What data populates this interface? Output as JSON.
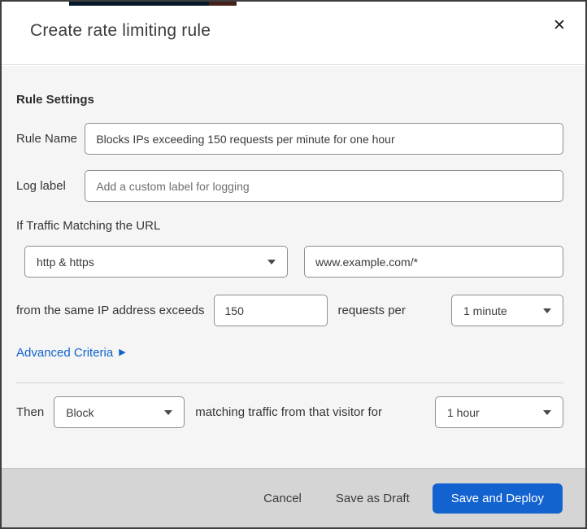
{
  "colors": {
    "accent_blue": "#1262d0",
    "link_blue": "#1063ce",
    "body_bg": "#f5f5f5",
    "footer_bg": "#d5d5d5",
    "top_sliver_navy": "#05192b"
  },
  "header": {
    "title": "Create rate limiting rule",
    "close_icon": "✕"
  },
  "form": {
    "section_heading": "Rule Settings",
    "rule_name": {
      "label": "Rule Name",
      "value": "Blocks IPs exceeding 150 requests per minute for one hour"
    },
    "log_label": {
      "label": "Log label",
      "placeholder": "Add a custom label for logging"
    },
    "match": {
      "intro": "If Traffic Matching the URL",
      "scheme_selected": "http & https",
      "url_value": "www.example.com/*"
    },
    "threshold": {
      "prefix": "from the same IP address exceeds",
      "requests_value": "150",
      "middle": "requests per",
      "period_selected": "1 minute"
    },
    "advanced_link": {
      "label": "Advanced Criteria",
      "arrow": "▶"
    },
    "action": {
      "then_label": "Then",
      "action_selected": "Block",
      "middle": "matching traffic from that visitor for",
      "duration_selected": "1 hour"
    }
  },
  "footer": {
    "cancel": "Cancel",
    "save_draft": "Save as Draft",
    "save_deploy": "Save and Deploy"
  }
}
